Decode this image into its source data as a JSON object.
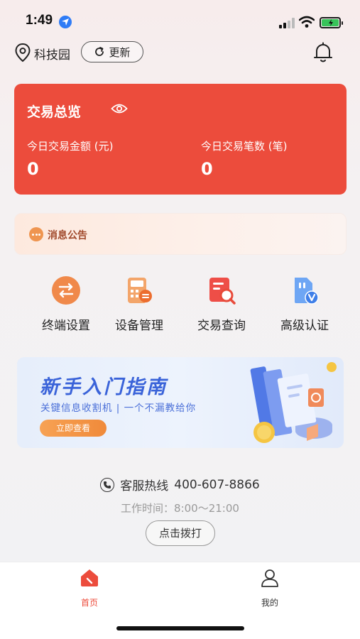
{
  "status_bar": {
    "time": "1:49"
  },
  "header": {
    "location": "科技园",
    "refresh_label": "更新"
  },
  "overview": {
    "title": "交易总览",
    "amount_label": "今日交易金额 (元)",
    "amount_value": "0",
    "count_label": "今日交易笔数 (笔)",
    "count_value": "0"
  },
  "notice": {
    "label": "消息公告"
  },
  "quick_menu": [
    {
      "label": "终端设置",
      "icon": "terminal-settings-icon"
    },
    {
      "label": "设备管理",
      "icon": "device-management-icon"
    },
    {
      "label": "交易查询",
      "icon": "transaction-query-icon"
    },
    {
      "label": "高级认证",
      "icon": "advanced-certification-icon"
    }
  ],
  "banner": {
    "title": "新手入门指南",
    "subtitle": "关键信息收割机 | 一个不漏教给你",
    "button": "立即查看"
  },
  "service": {
    "hotline_label": "客服热线",
    "hotline_number": "400-607-8866",
    "hours": "工作时间：8:00～21:00",
    "call_button": "点击拨打"
  },
  "tab_bar": {
    "home": "首页",
    "mine": "我的"
  },
  "colors": {
    "accent": "#ec4c3c",
    "notice_text": "#a14a2c",
    "banner_blue": "#3a63d9",
    "banner_button": "#f08a3a"
  }
}
